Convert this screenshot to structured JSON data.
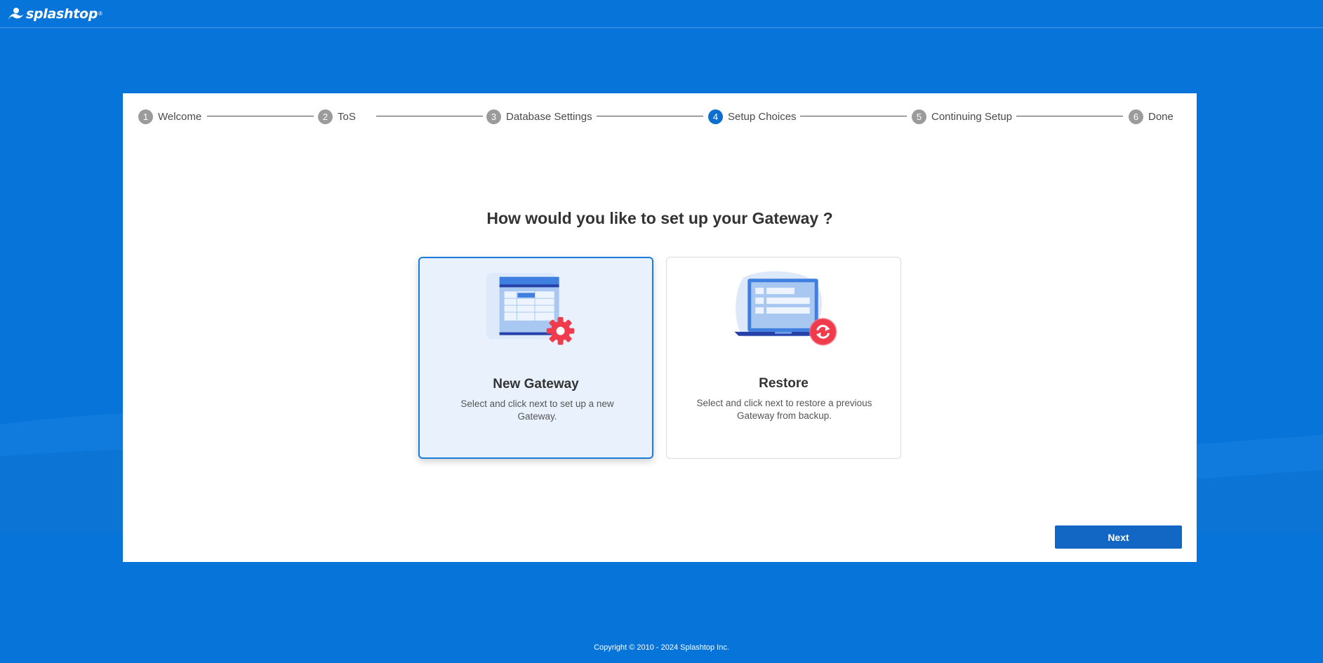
{
  "header": {
    "logo_text": "splashtop",
    "logo_tm": "®"
  },
  "stepper": {
    "steps": [
      {
        "number": "1",
        "label": "Welcome",
        "active": false
      },
      {
        "number": "2",
        "label": "ToS",
        "active": false
      },
      {
        "number": "3",
        "label": "Database Settings",
        "active": false
      },
      {
        "number": "4",
        "label": "Setup Choices",
        "active": true
      },
      {
        "number": "5",
        "label": "Continuing Setup",
        "active": false
      },
      {
        "number": "6",
        "label": "Done",
        "active": false
      }
    ]
  },
  "main": {
    "question": "How would you like to set up your Gateway ?",
    "options": [
      {
        "title": "New Gateway",
        "description": "Select and click next to set up a new Gateway.",
        "selected": true,
        "icon": "spreadsheet-gear-icon"
      },
      {
        "title": "Restore",
        "description": "Select and click next to restore a previous Gateway from backup.",
        "selected": false,
        "icon": "laptop-restore-icon"
      }
    ],
    "next_label": "Next"
  },
  "footer": {
    "copyright": "Copyright © 2010 - 2024 Splashtop Inc."
  },
  "colors": {
    "background": "#0674d9",
    "accent": "#0b6fcf",
    "button": "#1367c4",
    "restore_red": "#ef3b4c"
  }
}
